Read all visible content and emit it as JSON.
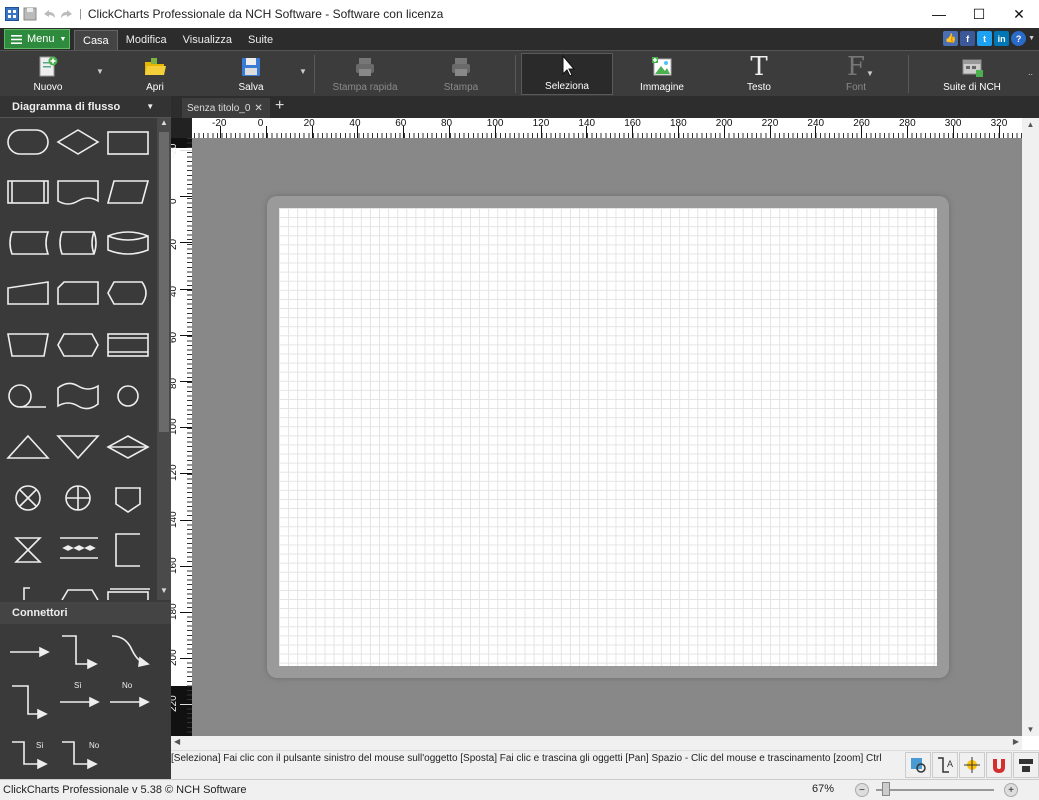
{
  "window": {
    "title": "ClickCharts Professionale da NCH Software - Software con licenza",
    "minimize": "—",
    "maximize": "☐",
    "close": "✕"
  },
  "menubar": {
    "menu_label": "Menu",
    "tabs": [
      "Casa",
      "Modifica",
      "Visualizza",
      "Suite"
    ]
  },
  "toolbar": {
    "buttons": [
      "Nuovo",
      "Apri",
      "Salva",
      "Stampa rapida",
      "Stampa",
      "Seleziona",
      "Immagine",
      "Testo",
      "Font",
      "Suite di NCH"
    ]
  },
  "left_panel": {
    "shapes_header": "Diagramma di flusso",
    "connectors_header": "Connettori",
    "connector_labels": {
      "yes": "Sì",
      "no": "No"
    }
  },
  "document": {
    "tab_title": "Senza titolo_0",
    "add_tab": "+"
  },
  "rulers": {
    "horizontal": [
      "-20",
      "0",
      "20",
      "40",
      "60",
      "80",
      "100",
      "120",
      "140",
      "160",
      "180",
      "200",
      "220",
      "240",
      "260",
      "280",
      "300",
      "320"
    ],
    "vertical": [
      "-20",
      "0",
      "20",
      "40",
      "60",
      "80",
      "100",
      "120",
      "140",
      "160",
      "180",
      "200",
      "220"
    ]
  },
  "status": {
    "hint": "[Seleziona] Fai clic con il pulsante sinistro del mouse sull'oggetto [Sposta] Fai clic e trascina gli oggetti [Pan] Spazio - Clic del mouse e trascinamento [zoom] Ctrl",
    "version": "ClickCharts Professionale v 5.38 © NCH Software",
    "zoom": "67%"
  },
  "colors": {
    "accent_green": "#2e8b3d",
    "toolbar_bg": "#3c3c3c",
    "canvas_bg": "#888888"
  }
}
